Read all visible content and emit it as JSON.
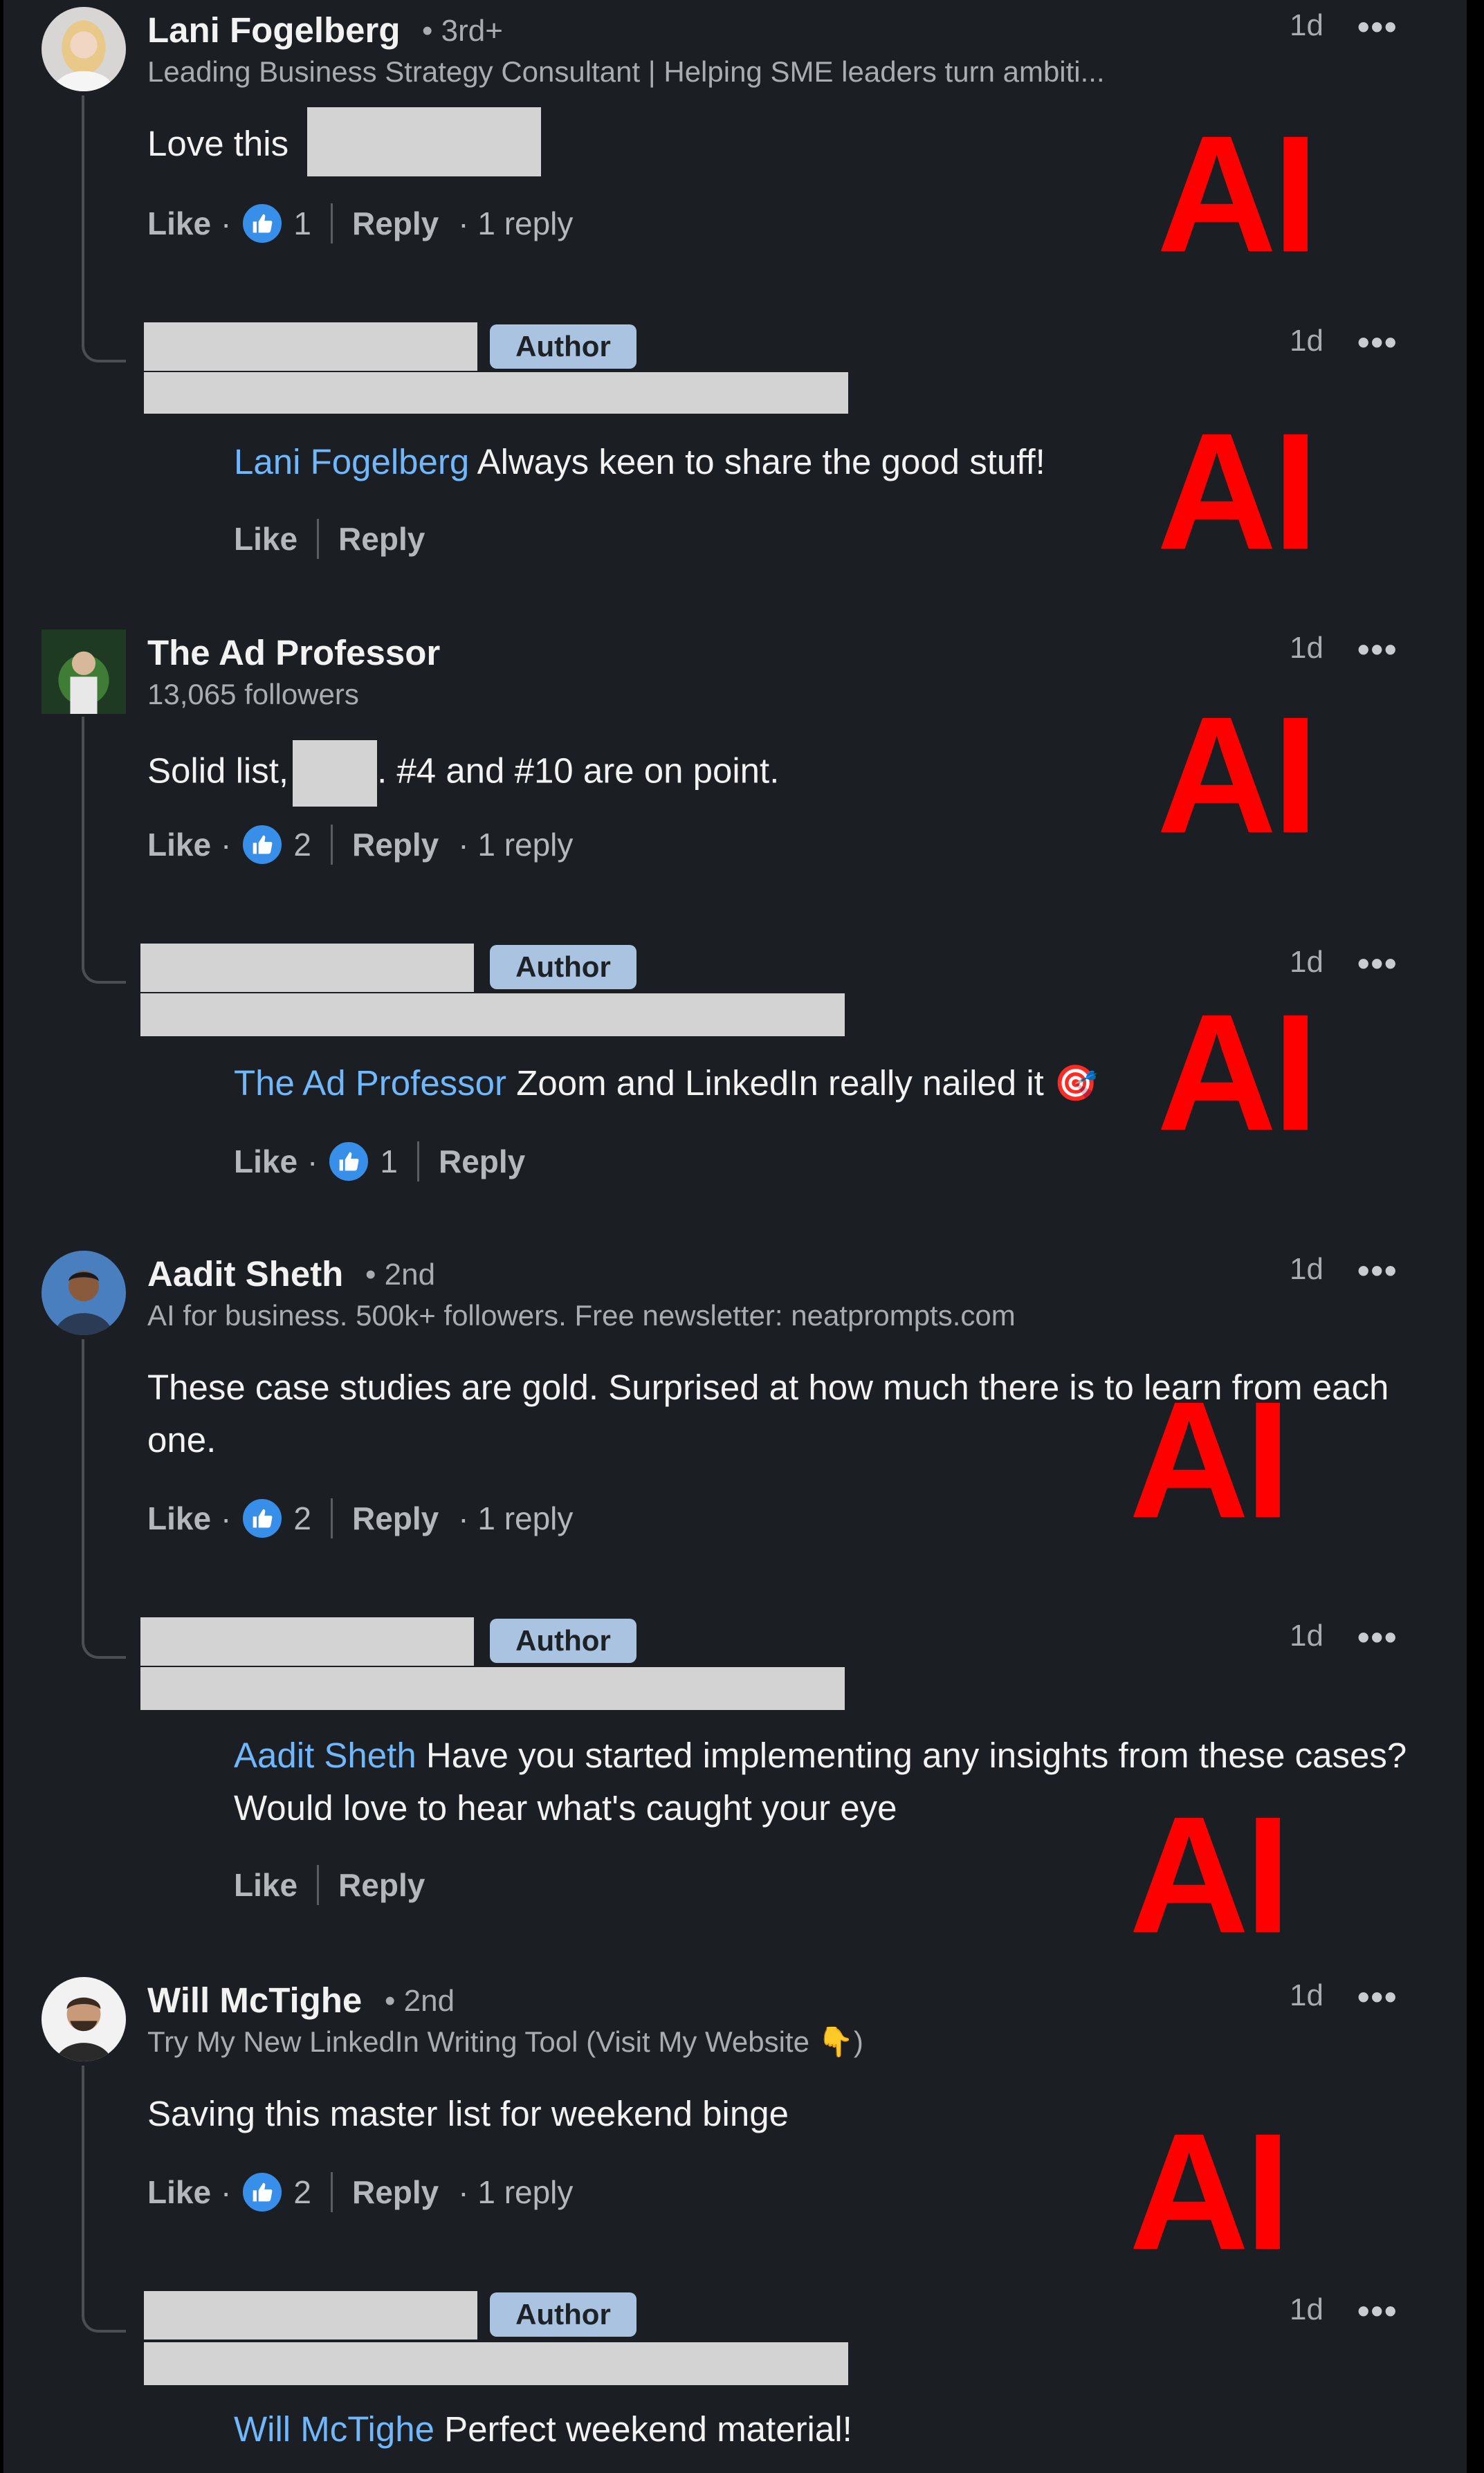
{
  "like_label": "Like",
  "reply_label": "Reply",
  "author_badge": "Author",
  "watermark": "AI",
  "comments": [
    {
      "name": "Lani Fogelberg",
      "degree": "• 3rd+",
      "headline": "Leading Business Strategy Consultant | Helping SME leaders turn ambiti...",
      "time": "1d",
      "text_before": "Love this",
      "reactions": "1",
      "replies": "· 1 reply",
      "reply": {
        "time": "1d",
        "mention": "Lani Fogelberg",
        "text": "Always keen to share the good stuff!"
      }
    },
    {
      "name": "The Ad Professor",
      "headline": "13,065 followers",
      "time": "1d",
      "text_before": "Solid list,",
      "text_after": ". #4 and #10 are on point.",
      "reactions": "2",
      "replies": "· 1 reply",
      "reply": {
        "time": "1d",
        "mention": "The Ad Professor",
        "text": "Zoom and LinkedIn really nailed it 🎯",
        "reactions": "1"
      }
    },
    {
      "name": "Aadit Sheth",
      "degree": "• 2nd",
      "headline": "AI for business. 500k+ followers. Free newsletter: neatprompts.com",
      "time": "1d",
      "text": "These case studies are gold. Surprised at how much there is to learn from each one.",
      "reactions": "2",
      "replies": "· 1 reply",
      "reply": {
        "time": "1d",
        "mention": "Aadit Sheth",
        "text": "Have you started implementing any insights from these cases? Would love to hear what's caught your eye"
      }
    },
    {
      "name": "Will McTighe",
      "degree": "• 2nd",
      "headline": "Try My New LinkedIn Writing Tool (Visit My Website 👇)",
      "time": "1d",
      "text": "Saving this master list for weekend binge",
      "reactions": "2",
      "replies": "· 1 reply",
      "reply": {
        "time": "1d",
        "mention": "Will McTighe",
        "text": "Perfect weekend material!"
      }
    }
  ],
  "colors": {
    "background": "#1b1f23",
    "mention": "#71b7fb",
    "like_badge": "#378fe9",
    "author_badge": "#a9c3e0",
    "watermark": "#ff0000"
  },
  "icons": [
    "more-options-icon",
    "thumbs-up-icon",
    "target-emoji",
    "pointing-down-emoji"
  ]
}
